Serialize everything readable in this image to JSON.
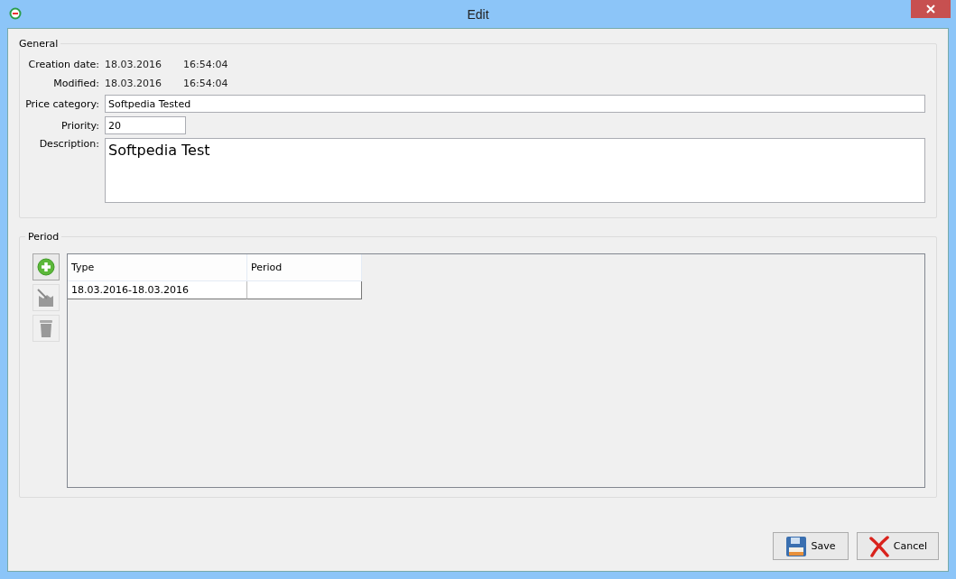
{
  "window": {
    "title": "Edit"
  },
  "general": {
    "legend": "General",
    "info": [
      {
        "label": "Creation date:",
        "date": "18.03.2016",
        "time": "16:54:04"
      },
      {
        "label": "Modified:",
        "date": "18.03.2016",
        "time": "16:54:04"
      }
    ],
    "price_category": {
      "label": "Price category:",
      "value": "Softpedia Tested"
    },
    "priority": {
      "label": "Priority:",
      "value": "20"
    },
    "description": {
      "label": "Description:",
      "value": "Softpedia Test"
    }
  },
  "period": {
    "legend": "Period",
    "tools": [
      {
        "kind": "add",
        "disabled": false
      },
      {
        "kind": "edit",
        "disabled": true
      },
      {
        "kind": "delete",
        "disabled": true
      }
    ],
    "table": {
      "columns": [
        "Type",
        "Period"
      ],
      "rows": [
        [
          "18.03.2016-18.03.2016",
          ""
        ]
      ]
    }
  },
  "buttons": [
    {
      "kind": "save",
      "label": "Save"
    },
    {
      "kind": "cancel",
      "label": "Cancel"
    }
  ]
}
